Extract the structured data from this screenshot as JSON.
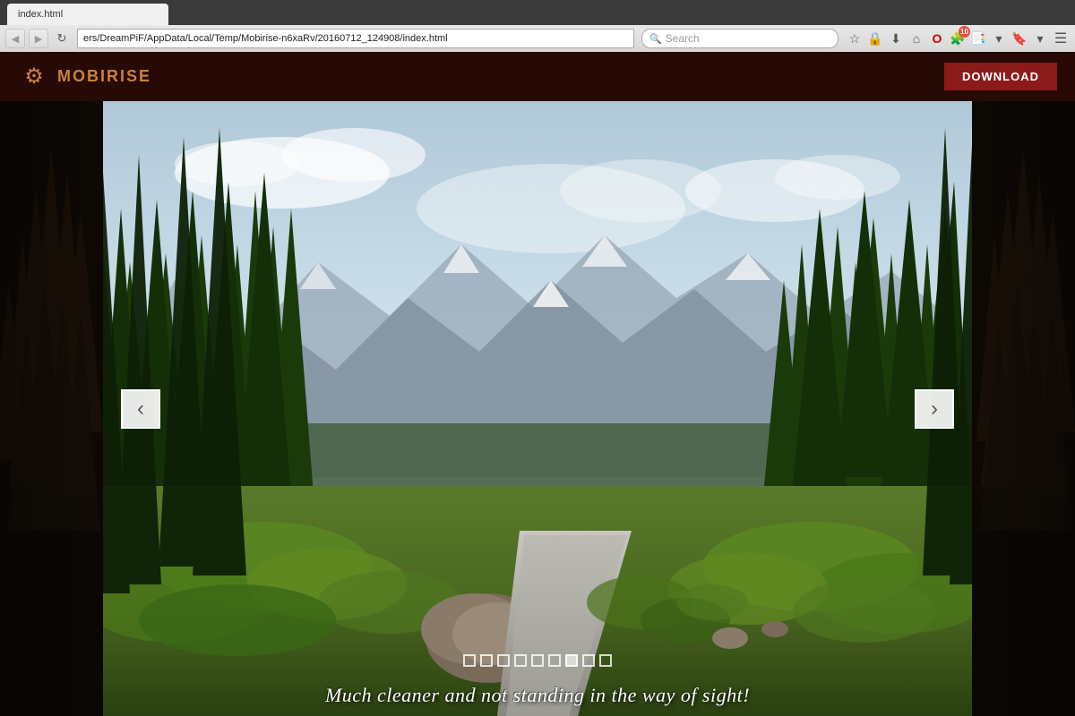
{
  "browser": {
    "tab_label": "index.html",
    "address": "ers/DreamPiF/AppData/Local/Temp/Mobirise-n6xaRv/20160712_124908/index.html",
    "search_placeholder": "Search",
    "reload_icon": "↻"
  },
  "toolbar_icons": {
    "star": "☆",
    "lock": "🔒",
    "download": "⬇",
    "home": "⌂",
    "opera": "O",
    "extensions": "🧩",
    "notification_count": "10",
    "bookmarks": "📑",
    "menu": "☰"
  },
  "app": {
    "logo_icon": "⚙",
    "logo_text": "MOBIRISE",
    "download_label": "DOWNLOAD"
  },
  "carousel": {
    "caption": "Much cleaner and not standing in the way of sight!",
    "dots_count": 9,
    "active_dot": 6,
    "prev_arrow": "‹",
    "next_arrow": "›"
  }
}
